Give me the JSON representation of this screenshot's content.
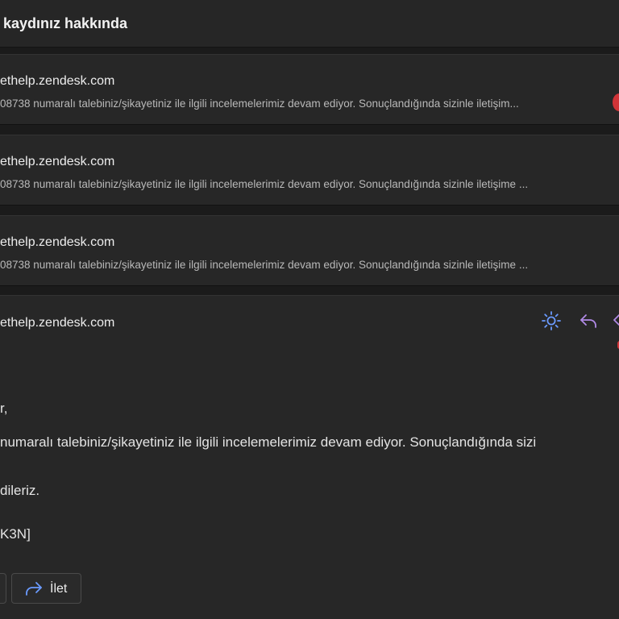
{
  "subject": "kaydınız hakkında",
  "collapsed_messages": [
    {
      "sender": "ethelp.zendesk.com",
      "preview": "08738 numaralı talebiniz/şikayetiniz ile ilgili incelemelerimiz devam ediyor. Sonuçlandığında sizinle iletişim...",
      "unread_badge": true
    },
    {
      "sender": "ethelp.zendesk.com",
      "preview": "08738 numaralı talebiniz/şikayetiniz ile ilgili incelemelerimiz devam ediyor. Sonuçlandığında sizinle iletişime ...",
      "unread_badge": false
    },
    {
      "sender": "ethelp.zendesk.com",
      "preview": "08738 numaralı talebiniz/şikayetiniz ile ilgili incelemelerimiz devam ediyor. Sonuçlandığında sizinle iletişime ...",
      "unread_badge": false
    }
  ],
  "expanded_message": {
    "sender": "ethelp.zendesk.com",
    "body": {
      "greeting": "r,",
      "paragraph": "numaralı talebiniz/şikayetiniz ile ilgili incelemelerimiz devam ediyor. Sonuçlandığında sizi",
      "closing": "dileriz.",
      "reference": "K3N]"
    },
    "actions": {
      "icons": [
        "sun-icon",
        "reply-icon",
        "reply-all-icon"
      ]
    },
    "buttons": {
      "forward_label": "İlet"
    }
  },
  "colors": {
    "accent_blue": "#6b9bff",
    "reply_purple": "#b18ae6",
    "badge_red": "#d13438"
  }
}
